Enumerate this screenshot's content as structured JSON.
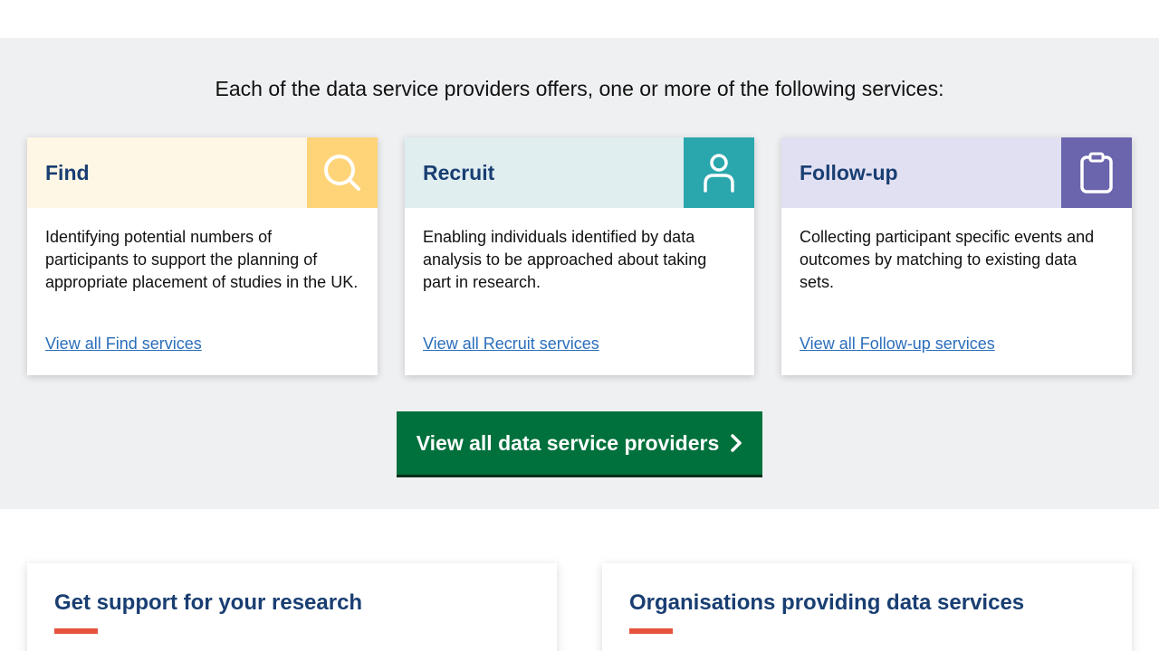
{
  "services": {
    "intro": "Each of the data service providers offers, one or more of the following services:",
    "cards": [
      {
        "title": "Find",
        "icon": "search-icon",
        "text": "Identifying potential numbers of participants to support the planning of appropriate placement of studies in the UK.",
        "link": "View all Find services"
      },
      {
        "title": "Recruit",
        "icon": "person-icon",
        "text": "Enabling individuals identified by data analysis to be approached about taking part in research.",
        "link": "View all Recruit services"
      },
      {
        "title": "Follow-up",
        "icon": "clipboard-icon",
        "text": "Collecting participant specific events and outcomes by matching to existing data sets.",
        "link": "View all Follow-up services"
      }
    ],
    "cta_label": "View all data service providers"
  },
  "panels": [
    {
      "title": "Get support for your research"
    },
    {
      "title": "Organisations providing data services"
    }
  ],
  "colors": {
    "heading": "#193e72",
    "link": "#2a6ebb",
    "cta": "#00703c",
    "accent_bar": "#e5533d",
    "find_icon_bg": "#ffd479",
    "recruit_icon_bg": "#2aa7ad",
    "followup_icon_bg": "#6a65ad"
  }
}
